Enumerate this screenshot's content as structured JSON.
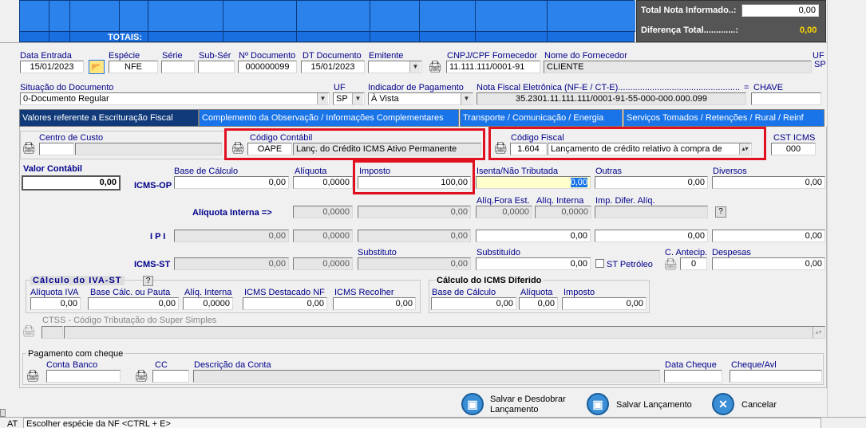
{
  "totals": {
    "label": "TOTAIS:",
    "nota_label": "Total Nota Informado..:",
    "nota_value": "0,00",
    "diff_label": "Diferença Total.............:",
    "diff_value": "0,00"
  },
  "header": {
    "data_entrada_label": "Data Entrada",
    "data_entrada": "15/01/2023",
    "especie_label": "Espécie",
    "especie": "NFE",
    "serie_label": "Série",
    "serie": "",
    "subser_label": "Sub-Sér",
    "subser": "",
    "ndoc_label": "Nº Documento",
    "ndoc": "000000099",
    "dtdoc_label": "DT Documento",
    "dtdoc": "15/01/2023",
    "emitente_label": "Emitente",
    "emitente": "",
    "cnpj_label": "CNPJ/CPF Fornecedor",
    "cnpj": "11.111.111/0001-91",
    "nome_label": "Nome do Fornecedor",
    "nome": "CLIENTE",
    "uf_label": "UF",
    "uf": "SP",
    "situacao_label": "Situação do Documento",
    "situacao": "0-Documento Regular",
    "uf2_label": "UF",
    "uf2": "SP",
    "indpag_label": "Indicador de Pagamento",
    "indpag": "À Vista",
    "nfe_label": "Nota Fiscal Eletrônica (NF-E / CT-E)..................................................",
    "eq": "=",
    "chave_label": "CHAVE",
    "nfe": "35.2301.11.111.111/0001-91-55-000-000.000.099",
    "chave": ""
  },
  "tabs": [
    "Valores referente a Escrituração Fiscal",
    "Complemento da Observação / Informações Complementares",
    "Transporte / Comunicação / Energia",
    "Serviços Tomados / Retenções / Rural / Reinf"
  ],
  "fiscal": {
    "centro_label": "Centro de Custo",
    "centro": "",
    "codcont_label": "Código Contábil",
    "codcont": "OAPE",
    "codcont_desc": "Lanç. do Crédito ICMS Ativo Permanente",
    "codfisc_label": "Código Fiscal",
    "codfisc": "1.604",
    "codfisc_desc": "Lançamento de crédito relativo à compra de",
    "cst_label": "CST ICMS",
    "cst": "000",
    "valor_contabil_label": "Valor Contábil",
    "valor_contabil": "0,00",
    "icmsop_label": "ICMS-OP",
    "base_label": "Base de Cálculo",
    "base": "0,00",
    "aliq_label": "Alíquota",
    "aliq": "0,0000",
    "imposto_label": "Imposto",
    "imposto": "100,00",
    "isenta_label": "Isenta/Não Tributada",
    "isenta": "0,00",
    "outras_label": "Outras",
    "outras": "0,00",
    "diversos_label": "Diversos",
    "diversos": "0,00",
    "aliqint_label": "Alíquota Interna =>",
    "aliqint": "0,0000",
    "aliqint2": "0,00",
    "aliqfora_label": "Alíq.Fora Est.",
    "aliqfora": "0,0000",
    "aliqinterna_label": "Alíq. Interna",
    "aliqinterna": "0,0000",
    "impdif_label": "Imp. Difer. Alíq.",
    "impdif": "",
    "ipi_label": "I P I",
    "ipi_base": "0,00",
    "ipi_aliq": "0,0000",
    "ipi_imp": "0,00",
    "ipi_isenta": "0,00",
    "ipi_outras": "0,00",
    "ipi_div": "0,00",
    "icmsst_label": "ICMS-ST",
    "st_base": "0,00",
    "st_aliq": "0,0000",
    "subst_label": "Substituto",
    "st_sub": "0,00",
    "substituido_label": "Substituído",
    "st_subd": "0,00",
    "stpet_label": "ST Petróleo",
    "canteci_label": "C. Antecip.",
    "canteci": "0",
    "despesas_label": "Despesas",
    "despesas": "0,00"
  },
  "iva": {
    "title": "Cálculo do IVA-ST",
    "q": "?",
    "aliqiva_label": "Alíquota IVA",
    "aliqiva": "0,00",
    "basecalc_label": "Base Cálc. ou Pauta",
    "basecalc": "0,00",
    "aliqint_label": "Alíq. Interna",
    "aliqint": "0,0000",
    "icmsdest_label": "ICMS Destacado NF",
    "icmsdest": "0,00",
    "icmsrec_label": "ICMS Recolher",
    "icmsrec": "0,00"
  },
  "diferido": {
    "title": "Cálculo do ICMS Diferido",
    "base_label": "Base de Cálculo",
    "base": "0,00",
    "aliq_label": "Alíquota",
    "aliq": "0,00",
    "imp_label": "Imposto",
    "imp": "0,00"
  },
  "ctss": {
    "label": "CTSS - Código Tributação do Super Simples",
    "code": "",
    "desc": ""
  },
  "cheque": {
    "title": "Pagamento com cheque",
    "conta_label": "Conta",
    "banco_label": "Banco",
    "cc_label": "CC",
    "desc_label": "Descrição da Conta",
    "data_label": "Data Cheque",
    "chq_label": "Cheque/Avl"
  },
  "buttons": {
    "salvar_desd": "Salvar e Desdobrar Lançamento",
    "salvar": "Salvar Lançamento",
    "cancelar": "Cancelar"
  },
  "status": {
    "at": "AT",
    "hint": "Escolher espécie da NF  <CTRL + E>"
  }
}
